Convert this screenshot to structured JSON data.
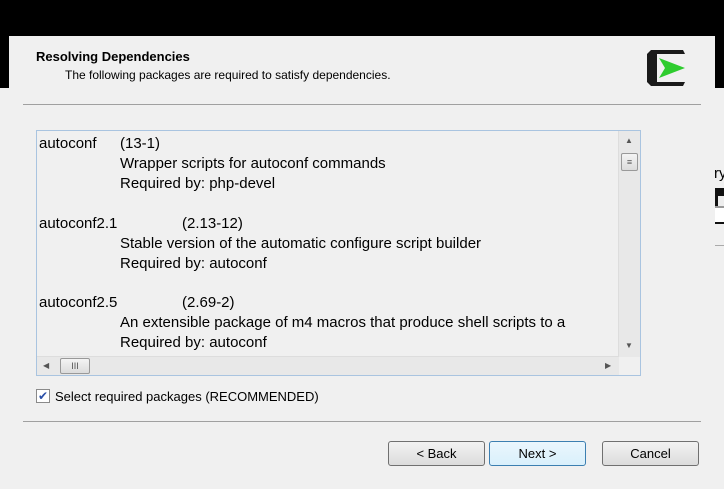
{
  "header": {
    "title": "Resolving Dependencies",
    "subtitle": "The following packages are required to satisfy dependencies."
  },
  "packages": [
    {
      "name": "autoconf",
      "version": "(13-1)",
      "description": "Wrapper scripts for autoconf commands",
      "required_by": "Required by: php-devel"
    },
    {
      "name": "autoconf2.1",
      "version": "(2.13-12)",
      "description": "Stable version of the automatic configure script builder",
      "required_by": "Required by: autoconf"
    },
    {
      "name": "autoconf2.5",
      "version": "(2.69-2)",
      "description": "An extensible package of m4 macros that produce shell scripts to a",
      "required_by": "Required by: autoconf"
    }
  ],
  "checkbox": {
    "label": "Select required packages (RECOMMENDED)",
    "checked": true
  },
  "buttons": {
    "back": "< Back",
    "next": "Next >",
    "cancel": "Cancel"
  },
  "background": {
    "partial_text": "ry"
  }
}
